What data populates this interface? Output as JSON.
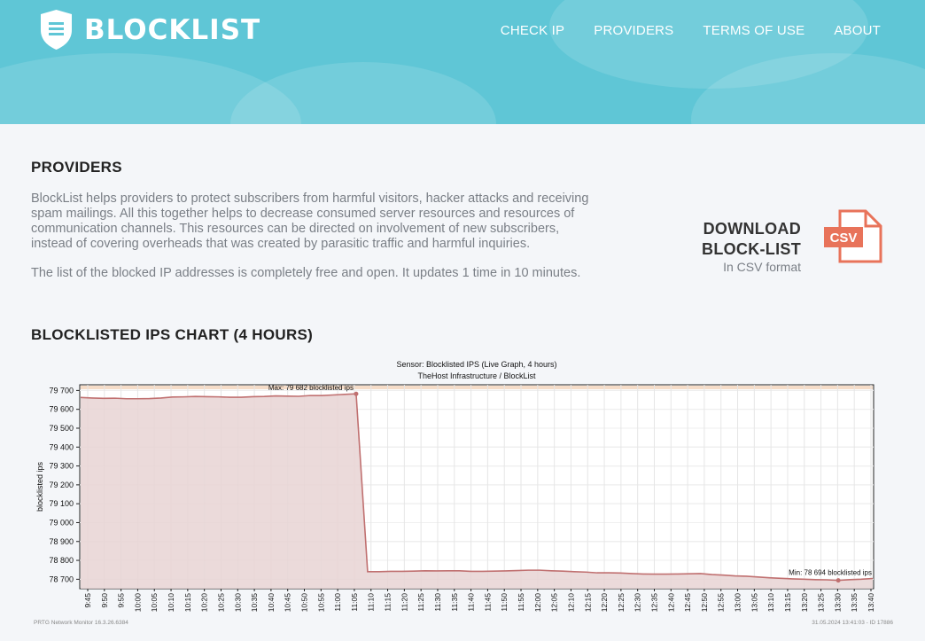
{
  "header": {
    "logo_text": "BLOCKLIST",
    "nav": [
      "CHECK IP",
      "PROVIDERS",
      "TERMS OF USE",
      "ABOUT"
    ]
  },
  "providers": {
    "title": "PROVIDERS",
    "paragraph1": "BlockList helps providers to protect subscribers from harmful visitors, hacker attacks and receiving spam mailings. All this together helps to decrease consumed server resources and resources of communication channels. This resources can be directed on involvement of new subscribers, instead of covering overheads that was created by parasitic traffic and harmful inquiries.",
    "paragraph2": "The list of the blocked IP addresses is completely free and open. It updates 1 time in 10 minutes."
  },
  "download": {
    "line1": "DOWNLOAD",
    "line2": "BLOCK-LIST",
    "sub": "In CSV format",
    "icon_label": "CSV"
  },
  "chart_section": {
    "title": "BLOCKLISTED IPS CHART (4 HOURS)"
  },
  "colors": {
    "hero": "#5fc6d6",
    "accent": "#e8735a",
    "series": "#c07070",
    "fill": "#e8d4d4"
  },
  "chart_data": {
    "type": "area",
    "title": "Sensor: Blocklisted IPS (Live Graph, 4 hours)",
    "subtitle": "TheHost Infrastructure / BlockList",
    "xlabel": "",
    "ylabel": "blocklisted ips",
    "ylim": [
      78650,
      79730
    ],
    "yticks": [
      79700,
      79600,
      79500,
      79400,
      79300,
      79200,
      79100,
      79000,
      78900,
      78800,
      78700
    ],
    "ytick_labels": [
      "79 700",
      "79 600",
      "79 500",
      "79 400",
      "79 300",
      "79 200",
      "79 100",
      "79 000",
      "78 900",
      "78 800",
      "78 700"
    ],
    "xticks": [
      "9:45",
      "9:50",
      "9:55",
      "10:00",
      "10:05",
      "10:10",
      "10:15",
      "10:20",
      "10:25",
      "10:30",
      "10:35",
      "10:40",
      "10:45",
      "10:50",
      "10:55",
      "11:00",
      "11:05",
      "11:10",
      "11:15",
      "11:20",
      "11:25",
      "11:30",
      "11:35",
      "11:40",
      "11:45",
      "11:50",
      "11:55",
      "12:00",
      "12:05",
      "12:10",
      "12:15",
      "12:20",
      "12:25",
      "12:30",
      "12:35",
      "12:40",
      "12:45",
      "12:50",
      "12:55",
      "13:00",
      "13:05",
      "13:10",
      "13:15",
      "13:20",
      "13:25",
      "13:30",
      "13:35",
      "13:40"
    ],
    "series": [
      {
        "values": [
          79663,
          79660,
          79658,
          79659,
          79656,
          79656,
          79657,
          79660,
          79665,
          79666,
          79668,
          79667,
          79666,
          79664,
          79664,
          79667,
          79668,
          79671,
          79670,
          79669,
          79673,
          79673,
          79676,
          79679,
          79682,
          78740,
          78740,
          78742,
          78742,
          78743,
          78745,
          78744,
          78745,
          78745,
          78742,
          78742,
          78743,
          78744,
          78746,
          78748,
          78748,
          78745,
          78743,
          78740,
          78738,
          78734,
          78734,
          78733,
          78730,
          78728,
          78727,
          78727,
          78728,
          78729,
          78730,
          78725,
          78722,
          78718,
          78716,
          78712,
          78708,
          78705,
          78702,
          78700,
          78698,
          78697,
          78694,
          78698,
          78700,
          78704
        ]
      }
    ],
    "max_label": "Max: 79 682 blocklisted ips",
    "min_label": "Min: 78 694 blocklisted ips",
    "grid": true,
    "footer_left": "PRTG Network Monitor 16.3.26.6384",
    "footer_right": "31.05.2024 13:41:03 - ID 17886"
  }
}
